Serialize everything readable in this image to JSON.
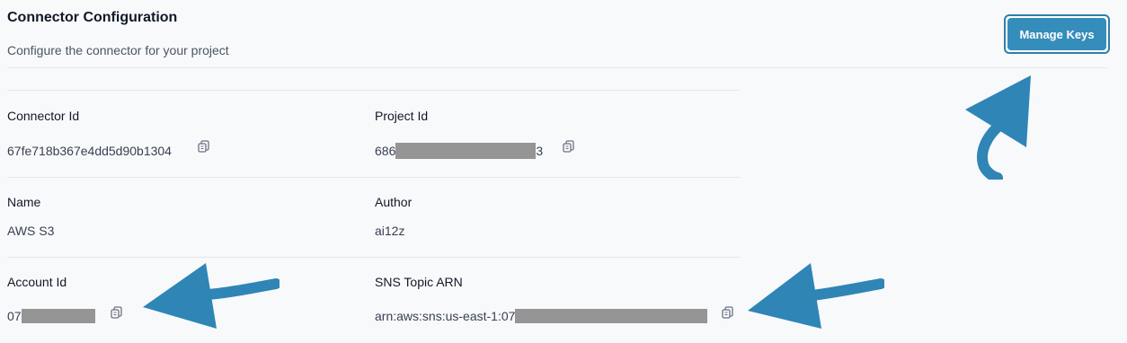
{
  "header": {
    "title": "Connector Configuration",
    "subtitle": "Configure the connector for your project",
    "manage_keys_label": "Manage Keys"
  },
  "fields": {
    "connector_id": {
      "label": "Connector Id",
      "value": "67fe718b367e4dd5d90b1304"
    },
    "project_id": {
      "label": "Project Id",
      "value_prefix": "686",
      "value_suffix": "3"
    },
    "name": {
      "label": "Name",
      "value": "AWS S3"
    },
    "author": {
      "label": "Author",
      "value": "ai12z"
    },
    "account_id": {
      "label": "Account Id",
      "value_prefix": "07"
    },
    "sns_topic_arn": {
      "label": "SNS Topic ARN",
      "value_prefix": "arn:aws:sns:us-east-1:07"
    }
  },
  "icons": {
    "copy": "copy-icon",
    "annotation_arrow": "arrow-icon"
  },
  "colors": {
    "accent": "#348dbb",
    "background": "#f8f9fb",
    "redaction": "#959595",
    "arrow": "#2f86b6"
  }
}
